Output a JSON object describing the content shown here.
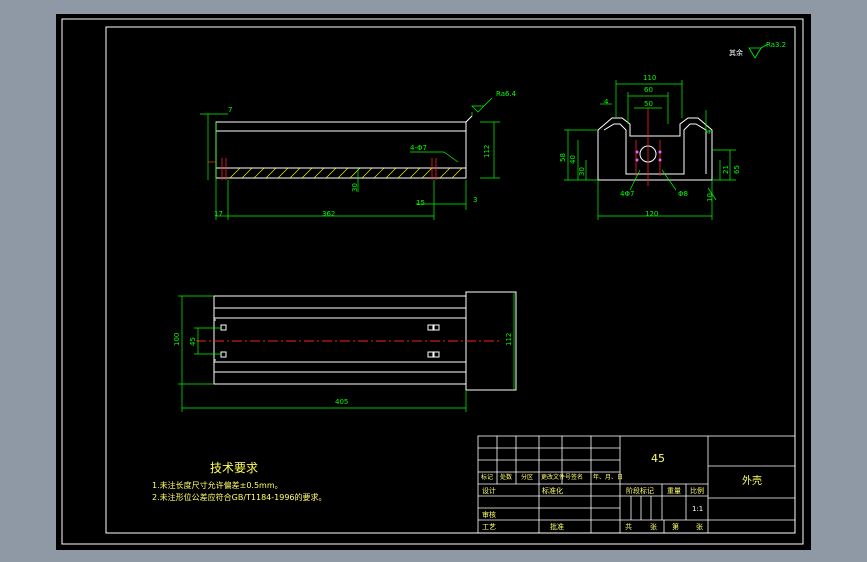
{
  "tech_requirements": {
    "title": "技术要求",
    "items": [
      "1.未注长度尺寸允许偏差±0.5mm。",
      "2.未注形位公差应符合GB/T1184-1996的要求。"
    ]
  },
  "roughness": {
    "general": "其余",
    "general_value": "Ra3.2",
    "front_value": "Ra6.4"
  },
  "front_view_dims": {
    "d_7": "7",
    "d_112": "112",
    "d_4m7": "4-Φ7",
    "d_30": "30",
    "d_17": "17",
    "d_362": "362",
    "d_15": "15",
    "d_3": "3"
  },
  "side_view_dims": {
    "d_110": "110",
    "d_60": "60",
    "d_50": "50",
    "d_4": "4",
    "d_58": "58",
    "d_40": "40",
    "d_30": "30",
    "d_65": "65",
    "d_4_2": "4",
    "d_4m7": "4Φ7",
    "d_phi": "Φ8",
    "d_21": "21",
    "d_45": "45",
    "d_10": "10",
    "d_120": "120"
  },
  "top_view_dims": {
    "d_100": "100",
    "d_45": "45",
    "d_112": "112",
    "d_405": "405"
  },
  "title_block": {
    "material": "45",
    "part_name": "外壳",
    "scale": "1:1",
    "headers": [
      "标记",
      "处数",
      "分区",
      "更改文件号",
      "签名",
      "年、月、日"
    ],
    "rows": [
      "设计",
      "审核",
      "工艺"
    ],
    "standardize": "标准化",
    "approve": "批准",
    "stage_mark": "阶段标记",
    "weight": "重量",
    "scale_label": "比例",
    "sheet_info": [
      "共",
      "张",
      "第",
      "张"
    ]
  }
}
